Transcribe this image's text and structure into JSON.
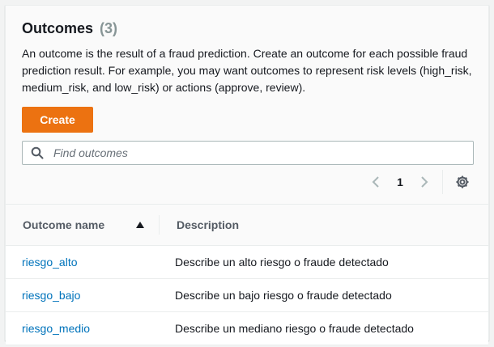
{
  "header": {
    "title": "Outcomes",
    "count": "(3)",
    "description": "An outcome is the result of a fraud prediction. Create an outcome for each possible fraud prediction result. For example, you may want outcomes to represent risk levels (high_risk, medium_risk, and low_risk) or actions (approve, review).",
    "create_label": "Create"
  },
  "search": {
    "placeholder": "Find outcomes",
    "icon": "search-icon"
  },
  "pagination": {
    "current_page": "1"
  },
  "table": {
    "columns": [
      "Outcome name",
      "Description"
    ],
    "rows": [
      {
        "name": "riesgo_alto",
        "description": "Describe un alto riesgo o fraude detectado"
      },
      {
        "name": "riesgo_bajo",
        "description": "Describe un bajo riesgo o fraude detectado"
      },
      {
        "name": "riesgo_medio",
        "description": "Describe un mediano riesgo o fraude detectado"
      }
    ]
  },
  "colors": {
    "primary_button": "#ec7211",
    "link": "#0073bb"
  }
}
